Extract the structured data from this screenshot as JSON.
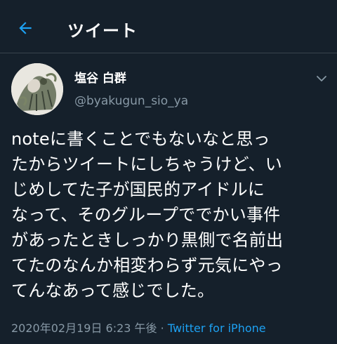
{
  "header": {
    "title": "ツイート",
    "back_icon": "arrow-left-icon",
    "accent_color": "#1da1f2"
  },
  "tweet": {
    "author": {
      "display_name": "塩谷 白群",
      "handle": "@byakugun_sio_ya",
      "avatar_icon": "avatar"
    },
    "menu_icon": "chevron-down-icon",
    "text": "noteに書くことでもないなと思っ\nたからツイートにしちゃうけど、い\nじめしてた子が国民的アイドルに\nなって、そのグループででかい事件\nがあったときしっかり黒側で名前出\nてたのなんか相変わらず元気にやっ\nてんなあって感じでした。",
    "timestamp": "2020年02月19日 6:23 午後",
    "separator": " · ",
    "source": "Twitter for iPhone"
  },
  "colors": {
    "background": "#15202b",
    "secondary_text": "#8899a6",
    "divider": "#38444d"
  }
}
